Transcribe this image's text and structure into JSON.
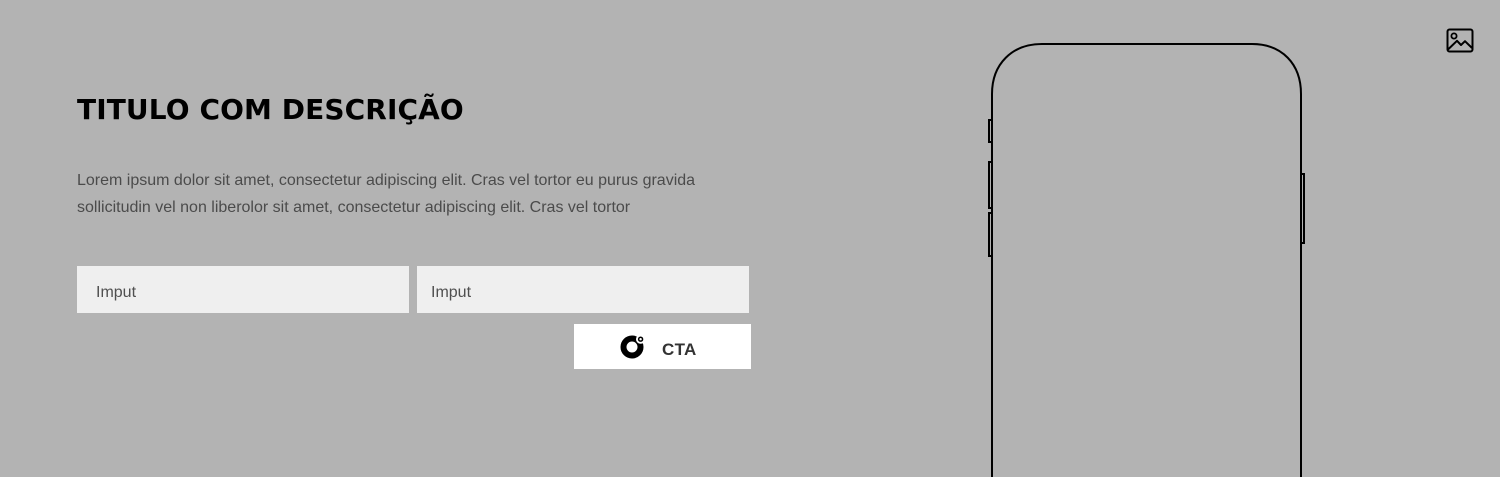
{
  "hero": {
    "title": "TITULO COM DESCRIÇÃO",
    "description": "Lorem ipsum dolor sit amet, consectetur adipiscing elit. Cras vel tortor eu purus gravida sollicitudin vel non liberolor sit amet, consectetur adipiscing elit. Cras vel tortor",
    "inputs": [
      {
        "placeholder": "Imput"
      },
      {
        "placeholder": "Imput"
      }
    ],
    "cta": {
      "label": "CTA",
      "icon": "ring-icon"
    },
    "image_placeholder_icon": "image-icon",
    "device_placeholder": "phone-outline"
  },
  "colors": {
    "background": "#b3b3b3",
    "input_background": "#efefef",
    "button_background": "#ffffff",
    "title": "#000000",
    "body_text": "#4b4b4b"
  }
}
